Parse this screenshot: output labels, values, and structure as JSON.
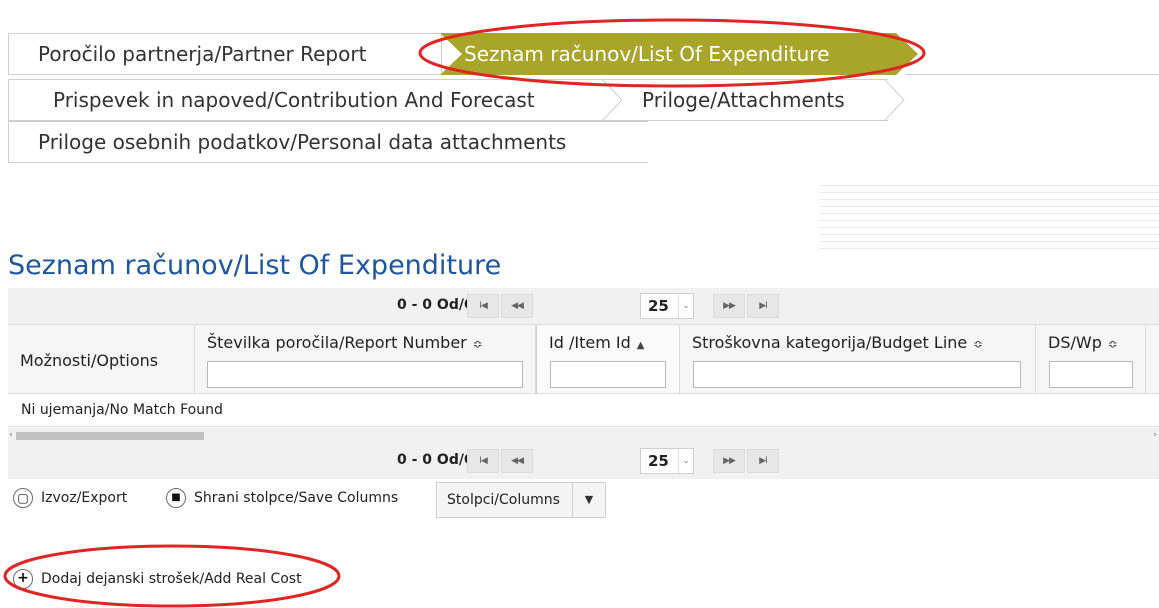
{
  "tabs": {
    "partner_report": "Poročilo partnerja/Partner Report",
    "list_of_expenditure": "Seznam računov/List Of Expenditure",
    "contribution_forecast": "Prispevek in napoved/Contribution And Forecast",
    "attachments": "Priloge/Attachments",
    "personal_data": "Priloge osebnih podatkov/Personal data attachments"
  },
  "page": {
    "title": "Seznam računov/List Of Expenditure"
  },
  "pager": {
    "info": "0 - 0 Od/Of 0",
    "rows_per_page": "25",
    "first_icon": "first-page-icon",
    "prev_icon": "previous-page-icon",
    "next_icon": "next-page-icon",
    "last_icon": "last-page-icon"
  },
  "table": {
    "columns": [
      {
        "label": "Možnosti/Options",
        "sortable": false,
        "filter": false
      },
      {
        "label": "Številka poročila/Report Number",
        "sortable": true,
        "filter": true
      },
      {
        "label": "Id /Item Id",
        "sortable": true,
        "sorted": "asc",
        "filter": true
      },
      {
        "label": "Stroškovna kategorija/Budget Line",
        "sortable": true,
        "filter": true
      },
      {
        "label": "DS/Wp",
        "sortable": true,
        "filter": true
      }
    ],
    "sort_both_icon": "≎",
    "sort_asc_icon": "▲",
    "empty_message": "Ni ujemanja/No Match Found"
  },
  "actions": {
    "export": "Izvoz/Export",
    "save_columns": "Shrani stolpce/Save Columns",
    "columns": "Stolpci/Columns",
    "add_real_cost": "Dodaj dejanski strošek/Add Real Cost"
  },
  "colors": {
    "active_tab": "#a9a52b",
    "title": "#1e56a0",
    "highlight": "#e02525"
  }
}
